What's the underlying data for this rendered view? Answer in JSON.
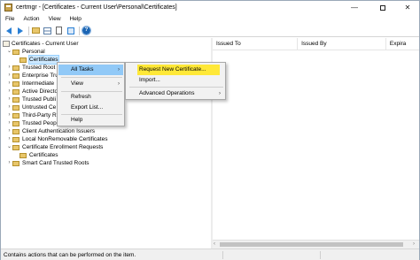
{
  "window": {
    "title": "certmgr - [Certificates - Current User\\Personal\\Certificates]",
    "minimize_glyph": "—",
    "close_glyph": "✕"
  },
  "menu": [
    "File",
    "Action",
    "View",
    "Help"
  ],
  "toolbar": {
    "icons": [
      "back-arrow-icon",
      "forward-arrow-icon",
      "folder-icon",
      "details-view-icon",
      "properties-icon",
      "export-icon",
      "help-icon"
    ],
    "help_glyph": "?"
  },
  "tree": {
    "expander": "›",
    "expander_open": "⌄",
    "nodes": [
      {
        "label": "Certificates - Current User",
        "level": 0,
        "expander": "",
        "icon": "certificate-store-icon"
      },
      {
        "label": "Personal",
        "level": 1,
        "expander": "open",
        "icon": "folder-icon"
      },
      {
        "label": "Certificates",
        "level": 2,
        "expander": "",
        "icon": "folder-icon",
        "selected": true
      },
      {
        "label": "Trusted Root",
        "level": 1,
        "expander": "closed",
        "icon": "folder-icon"
      },
      {
        "label": "Enterprise Tru",
        "level": 1,
        "expander": "closed",
        "icon": "folder-icon"
      },
      {
        "label": "Intermediate",
        "level": 1,
        "expander": "closed",
        "icon": "folder-icon"
      },
      {
        "label": "Active Directo",
        "level": 1,
        "expander": "closed",
        "icon": "folder-icon"
      },
      {
        "label": "Trusted Publi",
        "level": 1,
        "expander": "closed",
        "icon": "folder-icon"
      },
      {
        "label": "Untrusted Ce",
        "level": 1,
        "expander": "closed",
        "icon": "folder-icon"
      },
      {
        "label": "Third-Party R",
        "level": 1,
        "expander": "closed",
        "icon": "folder-icon"
      },
      {
        "label": "Trusted People",
        "level": 1,
        "expander": "closed",
        "icon": "folder-icon"
      },
      {
        "label": "Client Authentication Issuers",
        "level": 1,
        "expander": "closed",
        "icon": "folder-icon"
      },
      {
        "label": "Local NonRemovable Certificates",
        "level": 1,
        "expander": "closed",
        "icon": "folder-icon"
      },
      {
        "label": "Certificate Enrollment Requests",
        "level": 1,
        "expander": "open",
        "icon": "folder-icon"
      },
      {
        "label": "Certificates",
        "level": 2,
        "expander": "",
        "icon": "folder-icon"
      },
      {
        "label": "Smart Card Trusted Roots",
        "level": 1,
        "expander": "closed",
        "icon": "folder-icon"
      }
    ]
  },
  "list": {
    "columns": [
      "Issued To",
      "Issued By",
      "Expira"
    ]
  },
  "context_menu": {
    "items": [
      {
        "label": "All Tasks",
        "submenu": true,
        "highlight": true
      },
      {
        "label": "View",
        "submenu": true
      },
      {
        "label": "Refresh"
      },
      {
        "label": "Export List..."
      },
      {
        "label": "Help"
      }
    ],
    "submenu_glyph": "›"
  },
  "submenu": {
    "items": [
      {
        "label": "Request New Certificate...",
        "highlight": true
      },
      {
        "label": "Import..."
      },
      {
        "label": "Advanced Operations",
        "submenu": true
      }
    ]
  },
  "scrollbar": {
    "left_glyph": "‹",
    "right_glyph": "›"
  },
  "status": {
    "text": "Contains actions that can be performed on the item."
  }
}
